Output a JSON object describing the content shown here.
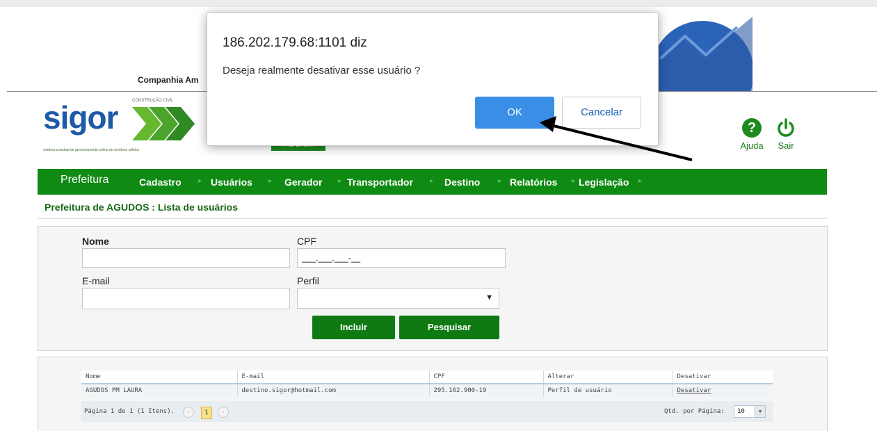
{
  "header": {
    "company": "Companhia Am",
    "logo_text": "sigor",
    "logo_tagline": "CONSTRUÇÃO CIVIL",
    "logo_subtitle": "sistema estadual de gerenciamento online de resíduos sólidos",
    "prefeitura_badge": "PREFEITURA",
    "help_label": "Ajuda",
    "logout_label": "Sair"
  },
  "nav": {
    "home": "Prefeitura",
    "items": [
      "Cadastro",
      "Usuários",
      "Gerador",
      "Transportador",
      "Destino",
      "Relatórios",
      "Legislação"
    ]
  },
  "page": {
    "title": "Prefeitura de AGUDOS : Lista de usuários"
  },
  "search": {
    "nome_label": "Nome",
    "nome_value": "",
    "cpf_label": "CPF",
    "cpf_value": "___.___.___-__",
    "email_label": "E-mail",
    "email_value": "",
    "perfil_label": "Perfil",
    "perfil_value": "",
    "incluir_label": "Incluir",
    "pesquisar_label": "Pesquisar"
  },
  "grid": {
    "columns": [
      "Nome",
      "E-mail",
      "CPF",
      "Alterar",
      "Desativar"
    ],
    "rows": [
      [
        "AGUDOS PM LAURA",
        "destino.sigor@hotmail.com",
        "295.162.900-19",
        "Perfil de usuário",
        "Desativar"
      ]
    ],
    "pager_text": "Página 1 de 1 (1 Itens).",
    "prev_icon": "‹",
    "current_page": "1",
    "next_icon": "›",
    "page_size_label": "Qtd. por Página:",
    "page_size_value": "10"
  },
  "dialog": {
    "title": "186.202.179.68:1101 diz",
    "message": "Deseja realmente desativar esse usuário ?",
    "ok_label": "OK",
    "cancel_label": "Cancelar"
  },
  "colors": {
    "nav_green": "#0f8a13",
    "button_green": "#0f7a12",
    "ok_blue": "#3b8ee6",
    "logo_blue": "#1d5aa8"
  },
  "icons": {
    "help": "question-circle-icon",
    "logout": "power-icon",
    "select_arrow": "caret-down-icon",
    "annotation": "black-arrow-icon"
  }
}
